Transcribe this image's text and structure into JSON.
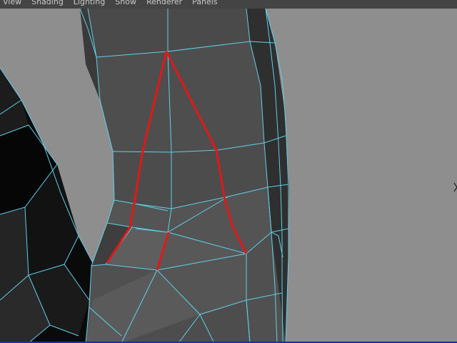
{
  "menu": {
    "items": [
      "View",
      "Shading",
      "Lighting",
      "Show",
      "Renderer",
      "Panels"
    ]
  },
  "colors": {
    "viewport_background": "#8e8e8e",
    "mesh_face": "#4b4b4b",
    "mesh_dark": "#2c2c2c",
    "wireframe": "#5fd0e8",
    "highlight_edge": "#e01818",
    "menubar": "#444444",
    "menubar_text": "#c8c8c8"
  },
  "viewport": {
    "panel": "perspective-viewport",
    "display_mode": "wireframe-on-shaded",
    "selection": "edge-loop"
  }
}
